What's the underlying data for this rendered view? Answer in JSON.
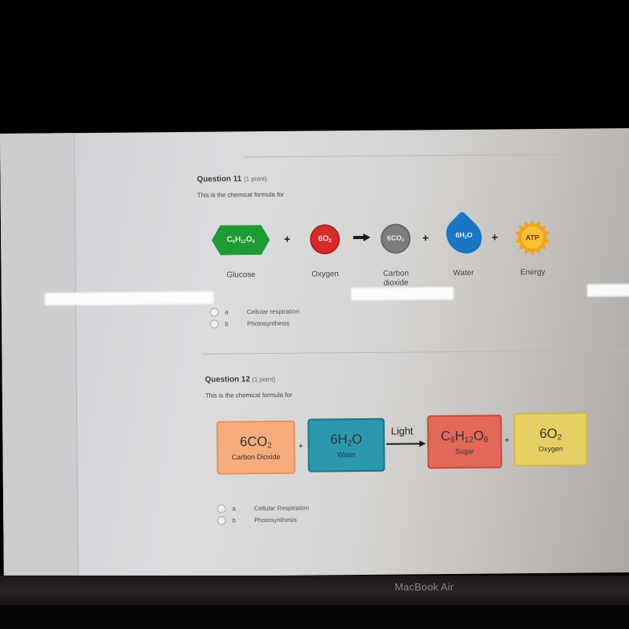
{
  "device": {
    "brand_label": "MacBook Air"
  },
  "questions": [
    {
      "number_label": "Question 11",
      "points_label": "(1 point)",
      "prompt": "This is the chemical formula for",
      "diagram": {
        "reactants": [
          {
            "formula_base": "C",
            "formula_parts": [
              "6",
              "H",
              "12",
              "O",
              "6"
            ],
            "formula_text": "C6H12O6",
            "caption": "Glucose",
            "shape": "hexagon",
            "color": "#1f9a34"
          },
          {
            "formula_text": "6O2",
            "caption": "Oxygen",
            "shape": "circle",
            "color": "#d62b2b"
          }
        ],
        "products": [
          {
            "formula_text": "6CO2",
            "caption_line1": "Carbon",
            "caption_line2": "dioxide",
            "shape": "circle",
            "color": "#7d7d7d"
          },
          {
            "formula_text": "6H2O",
            "caption": "Water",
            "shape": "drop",
            "color": "#1a76c4"
          },
          {
            "formula_text": "ATP",
            "caption": "Energy",
            "shape": "sun",
            "color": "#f1a51d"
          }
        ],
        "plus": "+"
      },
      "options": [
        {
          "letter": "a",
          "text": "Cellular respiration",
          "selected": false
        },
        {
          "letter": "b",
          "text": "Photosynthesis",
          "selected": false
        }
      ]
    },
    {
      "number_label": "Question 12",
      "points_label": "(1 point)",
      "prompt": "This is the chemical formula for",
      "diagram": {
        "items": [
          {
            "formula_text": "6CO2",
            "name": "Carbon Dioxide",
            "color": "#f5ad7d"
          },
          {
            "formula_text": "6H2O",
            "name": "Water",
            "color": "#2b98ad"
          },
          {
            "formula_text": "C6H12O6",
            "name": "Sugar",
            "color": "#e2685a"
          },
          {
            "formula_text": "6O2",
            "name": "Oxygen",
            "color": "#e6d062"
          }
        ],
        "arrow_label": "Light",
        "plus": "+"
      },
      "options": [
        {
          "letter": "a",
          "text": "Cellular Respiration",
          "selected": false
        },
        {
          "letter": "b",
          "text": "Photosynthesis",
          "selected": false
        }
      ]
    }
  ]
}
